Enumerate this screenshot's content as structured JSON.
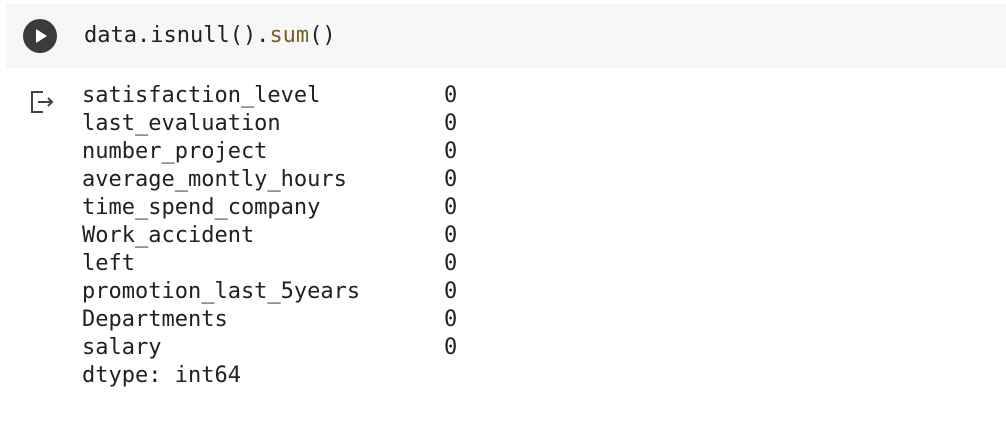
{
  "cell": {
    "code_prefix": "data.isnull().",
    "code_function": "sum",
    "code_suffix": "()"
  },
  "output": {
    "rows": [
      {
        "name": "satisfaction_level",
        "value": "0"
      },
      {
        "name": "last_evaluation",
        "value": "0"
      },
      {
        "name": "number_project",
        "value": "0"
      },
      {
        "name": "average_montly_hours",
        "value": "0"
      },
      {
        "name": "time_spend_company",
        "value": "0"
      },
      {
        "name": "Work_accident",
        "value": "0"
      },
      {
        "name": "left",
        "value": "0"
      },
      {
        "name": "promotion_last_5years",
        "value": "0"
      },
      {
        "name": "Departments",
        "value": "0"
      },
      {
        "name": "salary",
        "value": "0"
      }
    ],
    "dtype": "dtype: int64"
  },
  "icons": {
    "run": "play-icon",
    "output": "output-redirect-icon"
  },
  "colors": {
    "cell_background": "#f7f7f7",
    "run_button": "#3c3c3c",
    "function_name": "#795e26",
    "text": "#212121"
  }
}
